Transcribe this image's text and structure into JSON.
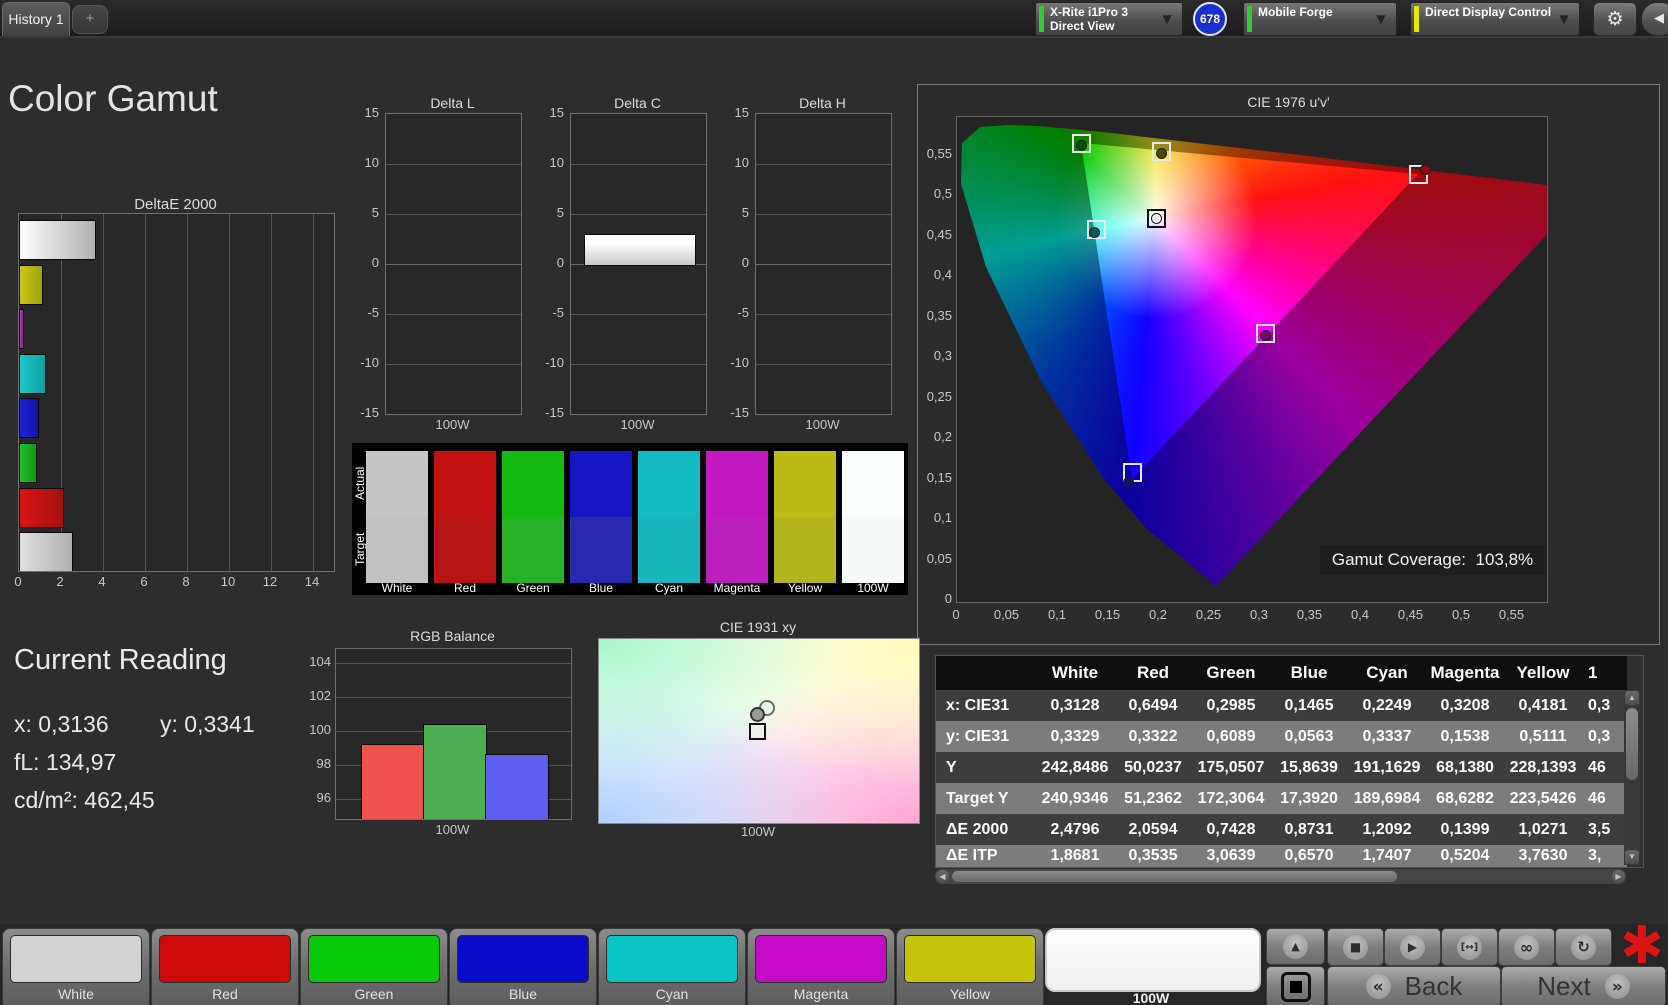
{
  "app": {
    "tab_title": "History 1",
    "add_tab": "+",
    "meter_device": {
      "line1": "X-Rite i1Pro 3",
      "line2": "Direct View"
    },
    "badge_count": "678",
    "pattern_source": "Mobile Forge",
    "display_control": "Direct Display Control"
  },
  "page_title": "Color Gamut",
  "deltae2000": {
    "title": "DeltaE 2000",
    "xticks": [
      "0",
      "2",
      "4",
      "6",
      "8",
      "10",
      "12",
      "14"
    ],
    "bars": [
      {
        "name": "100W",
        "value": 3.55,
        "color1": "#ffffff",
        "color2": "#b0b0b0"
      },
      {
        "name": "Yellow",
        "value": 1.03,
        "color1": "#c8c814",
        "color2": "#a0a010"
      },
      {
        "name": "Magenta",
        "value": 0.14,
        "color1": "#b030b0",
        "color2": "#8c288c"
      },
      {
        "name": "Cyan",
        "value": 1.21,
        "color1": "#18c8c8",
        "color2": "#10a0a0"
      },
      {
        "name": "Blue",
        "value": 0.87,
        "color1": "#2020d8",
        "color2": "#1414a8"
      },
      {
        "name": "Green",
        "value": 0.74,
        "color1": "#20c020",
        "color2": "#149814"
      },
      {
        "name": "Red",
        "value": 2.06,
        "color1": "#d81414",
        "color2": "#a81010"
      },
      {
        "name": "White",
        "value": 2.48,
        "color1": "#e0e0e0",
        "color2": "#b0b0b0"
      }
    ]
  },
  "delta_yticks": [
    "15",
    "10",
    "5",
    "0",
    "-5",
    "-10",
    "-15"
  ],
  "delta_charts": [
    {
      "title": "Delta L",
      "xlabel": "100W",
      "bar_value": null
    },
    {
      "title": "Delta C",
      "xlabel": "100W",
      "bar_value": 3.0
    },
    {
      "title": "Delta H",
      "xlabel": "100W",
      "bar_value": null
    }
  ],
  "swatch_strip": {
    "row_labels": [
      "Actual",
      "Target"
    ],
    "columns": [
      {
        "name": "White",
        "actual": "#c6c6c6",
        "target": "#c2c2c2"
      },
      {
        "name": "Red",
        "actual": "#c01010",
        "target": "#b51414"
      },
      {
        "name": "Green",
        "actual": "#12ba12",
        "target": "#28b228"
      },
      {
        "name": "Blue",
        "actual": "#1616c4",
        "target": "#2828ae"
      },
      {
        "name": "Cyan",
        "actual": "#12bac2",
        "target": "#1ab4bc"
      },
      {
        "name": "Magenta",
        "actual": "#c218c2",
        "target": "#bc20bc"
      },
      {
        "name": "Yellow",
        "actual": "#bcbc16",
        "target": "#b4b41c"
      },
      {
        "name": "100W",
        "actual": "#fbfffb",
        "target": "#f6faf6"
      }
    ]
  },
  "cie1976": {
    "title": "CIE 1976 u'v'",
    "xticks": [
      "0",
      "0,05",
      "0,1",
      "0,15",
      "0,2",
      "0,25",
      "0,3",
      "0,35",
      "0,4",
      "0,45",
      "0,5",
      "0,55"
    ],
    "yticks": [
      "0",
      "0,05",
      "0,1",
      "0,15",
      "0,2",
      "0,25",
      "0,3",
      "0,35",
      "0,4",
      "0,45",
      "0,5",
      "0,55"
    ],
    "coverage_label": "Gamut Coverage:",
    "coverage_value": "103,8%",
    "markers": [
      {
        "name": "green",
        "u": 0.123,
        "v": 0.5644,
        "dot": "#0c4f0c",
        "frame": "#e8e8e8",
        "dx": 0,
        "dy": 2
      },
      {
        "name": "yellow",
        "u": 0.2016,
        "v": 0.5544,
        "dot": "#4a4a08",
        "frame": "#e8e8e8",
        "dx": 0,
        "dy": 2
      },
      {
        "name": "red",
        "u": 0.4567,
        "v": 0.5257,
        "dot": "#8a0c0c",
        "frame": "#e8e8e8",
        "dx": 7,
        "dy": -5
      },
      {
        "name": "white",
        "u": 0.1966,
        "v": 0.4712,
        "dot": "#f4f4f4",
        "frame": "#0c0c0c",
        "dx": 0,
        "dy": 0
      },
      {
        "name": "cyan",
        "u": 0.1372,
        "v": 0.4582,
        "dot": "#0c5a5a",
        "frame": "#e8e8e8",
        "dx": -2,
        "dy": 3
      },
      {
        "name": "magenta",
        "u": 0.3052,
        "v": 0.3292,
        "dot": "#6e0c5e",
        "frame": "#e8e8e8",
        "dx": 0,
        "dy": 2
      },
      {
        "name": "blue",
        "u": 0.1732,
        "v": 0.158,
        "dot": "#10106e",
        "frame": "#e8e8e8",
        "dx": -4,
        "dy": 10
      }
    ]
  },
  "current_reading": {
    "title": "Current Reading",
    "items": [
      {
        "label": "x:",
        "value": "0,3136"
      },
      {
        "label": "y:",
        "value": "0,3341"
      },
      {
        "label": "fL:",
        "value": "134,97"
      },
      {
        "label": "cd/m²:",
        "value": "462,45"
      }
    ]
  },
  "rgb_balance": {
    "title": "RGB Balance",
    "xlabel": "100W",
    "yticks": [
      "104",
      "102",
      "100",
      "98",
      "96"
    ],
    "bars": [
      {
        "name": "Red",
        "value": 99.2,
        "color": "#ef5350"
      },
      {
        "name": "Green",
        "value": 100.4,
        "color": "#4cae50"
      },
      {
        "name": "Blue",
        "value": 98.6,
        "color": "#5e5ef0"
      }
    ]
  },
  "cie1931": {
    "title": "CIE 1931 xy",
    "xlabel": "100W"
  },
  "table": {
    "columns": [
      "White",
      "Red",
      "Green",
      "Blue",
      "Cyan",
      "Magenta",
      "Yellow"
    ],
    "partial_column": "1",
    "rows": [
      {
        "label": "x: CIE31",
        "values": [
          "0,3128",
          "0,6494",
          "0,2985",
          "0,1465",
          "0,2249",
          "0,3208",
          "0,4181"
        ],
        "partial": "0,3"
      },
      {
        "label": "y: CIE31",
        "values": [
          "0,3329",
          "0,3322",
          "0,6089",
          "0,0563",
          "0,3337",
          "0,1538",
          "0,5111"
        ],
        "partial": "0,3"
      },
      {
        "label": "Y",
        "values": [
          "242,8486",
          "50,0237",
          "175,0507",
          "15,8639",
          "191,1629",
          "68,1380",
          "228,1393"
        ],
        "partial": "46"
      },
      {
        "label": "Target Y",
        "values": [
          "240,9346",
          "51,2362",
          "172,3064",
          "17,3920",
          "189,6984",
          "68,6282",
          "223,5426"
        ],
        "partial": "46"
      },
      {
        "label": "ΔE 2000",
        "values": [
          "2,4796",
          "2,0594",
          "0,7428",
          "0,8731",
          "1,2092",
          "0,1399",
          "1,0271"
        ],
        "partial": "3,5"
      },
      {
        "label": "ΔE ITP",
        "values": [
          "1,8681",
          "0,3535",
          "3,0639",
          "0,6570",
          "1,7407",
          "0,5204",
          "3,7630"
        ],
        "partial": "3,"
      }
    ]
  },
  "bottom_bar": {
    "patches": [
      {
        "name": "White",
        "color": "#d2d2d2"
      },
      {
        "name": "Red",
        "color": "#cc0a0a"
      },
      {
        "name": "Green",
        "color": "#0ac80a"
      },
      {
        "name": "Blue",
        "color": "#0a0ac8"
      },
      {
        "name": "Cyan",
        "color": "#0ac4c4"
      },
      {
        "name": "Magenta",
        "color": "#c40ac4"
      },
      {
        "name": "Yellow",
        "color": "#c4c40a"
      }
    ],
    "selected_patch": "100W",
    "back_label": "Back",
    "next_label": "Next"
  },
  "chart_data": [
    {
      "type": "bar",
      "title": "DeltaE 2000",
      "orientation": "horizontal",
      "xlim": [
        0,
        15
      ],
      "categories": [
        "100W",
        "Yellow",
        "Magenta",
        "Cyan",
        "Blue",
        "Green",
        "Red",
        "White"
      ],
      "values": [
        3.55,
        1.03,
        0.14,
        1.21,
        0.87,
        0.74,
        2.06,
        2.48
      ]
    },
    {
      "type": "bar",
      "title": "Delta L",
      "categories": [
        "100W"
      ],
      "values": [
        0
      ],
      "ylim": [
        -15,
        15
      ]
    },
    {
      "type": "bar",
      "title": "Delta C",
      "categories": [
        "100W"
      ],
      "values": [
        3.0
      ],
      "ylim": [
        -15,
        15
      ]
    },
    {
      "type": "bar",
      "title": "Delta H",
      "categories": [
        "100W"
      ],
      "values": [
        0
      ],
      "ylim": [
        -15,
        15
      ]
    },
    {
      "type": "bar",
      "title": "RGB Balance",
      "categories": [
        "Red",
        "Green",
        "Blue"
      ],
      "values": [
        99.2,
        100.4,
        98.6
      ],
      "ylim": [
        94.8,
        105
      ],
      "xlabel": "100W"
    },
    {
      "type": "scatter",
      "title": "CIE 1976 u'v'",
      "xlabel": "u'",
      "ylabel": "v'",
      "xlim": [
        0,
        0.584
      ],
      "ylim": [
        0,
        0.6
      ],
      "annotation": "Gamut Coverage: 103,8%",
      "points": [
        {
          "name": "green",
          "u": 0.123,
          "v": 0.5644
        },
        {
          "name": "yellow",
          "u": 0.2016,
          "v": 0.5544
        },
        {
          "name": "red",
          "u": 0.4567,
          "v": 0.5257
        },
        {
          "name": "white",
          "u": 0.1966,
          "v": 0.4712
        },
        {
          "name": "cyan",
          "u": 0.1372,
          "v": 0.4582
        },
        {
          "name": "magenta",
          "u": 0.3052,
          "v": 0.3292
        },
        {
          "name": "blue",
          "u": 0.1732,
          "v": 0.158
        }
      ]
    }
  ]
}
